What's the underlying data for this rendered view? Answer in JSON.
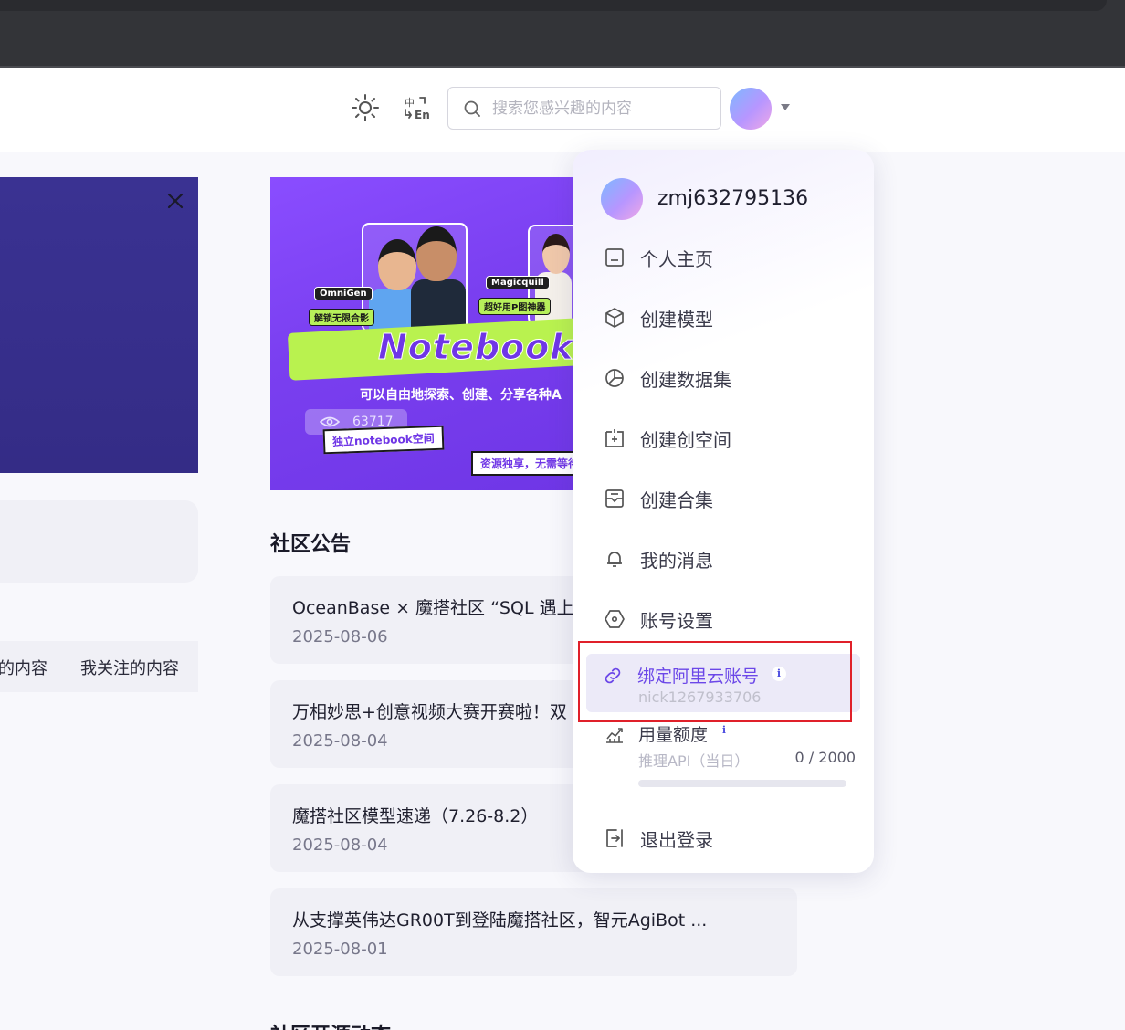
{
  "header": {
    "search_placeholder": "搜索您感兴趣的内容",
    "icons": [
      "sun-icon",
      "language-toggle-icon",
      "search-icon",
      "avatar",
      "chevron-down-icon"
    ]
  },
  "left": {
    "tabs": [
      "的内容",
      "我关注的内容"
    ]
  },
  "banner": {
    "tag_left": "OmniGen",
    "tag_left_sub": "解锁无限合影",
    "tag_right": "Magicquill",
    "tag_right_sub": "超好用P图神器",
    "title": "Notebook C",
    "subtitle": "可以自由地探索、创建、分享各种A",
    "button_left": "独立notebook空间",
    "button_right": "资源独享，无需等待",
    "views": "63717"
  },
  "announcements": {
    "title": "社区公告",
    "items": [
      {
        "title": "OceanBase × 魔搭社区 “SQL 遇上",
        "date": "2025-08-06"
      },
      {
        "title": "万相妙思+创意视频大赛开赛啦！双",
        "date": "2025-08-04"
      },
      {
        "title": "魔搭社区模型速递（7.26-8.2）",
        "date": "2025-08-04"
      },
      {
        "title": "从支撑英伟达GR00T到登陆魔搭社区，智元AgiBot ...",
        "date": "2025-08-01"
      }
    ],
    "next_section_title": "社区开源动态"
  },
  "dropdown": {
    "username": "zmj632795136",
    "items": [
      {
        "label": "个人主页",
        "icon": "home-icon"
      },
      {
        "label": "创建模型",
        "icon": "cube-icon"
      },
      {
        "label": "创建数据集",
        "icon": "pie-chart-icon"
      },
      {
        "label": "创建创空间",
        "icon": "add-space-icon"
      },
      {
        "label": "创建合集",
        "icon": "collection-icon"
      },
      {
        "label": "我的消息",
        "icon": "bell-icon"
      },
      {
        "label": "账号设置",
        "icon": "settings-icon"
      }
    ],
    "bind_aliyun": {
      "label": "绑定阿里云账号",
      "account": "nick1267933706",
      "info": "i"
    },
    "usage": {
      "label": "用量额度",
      "info": "i",
      "sub_label": "推理API（当日）",
      "used": 0,
      "total": 2000,
      "count_text": "0 / 2000"
    },
    "logout": {
      "label": "退出登录",
      "icon": "logout-icon"
    },
    "colors": {
      "accent": "#6b47e8",
      "highlight_border": "#e0202a"
    }
  }
}
